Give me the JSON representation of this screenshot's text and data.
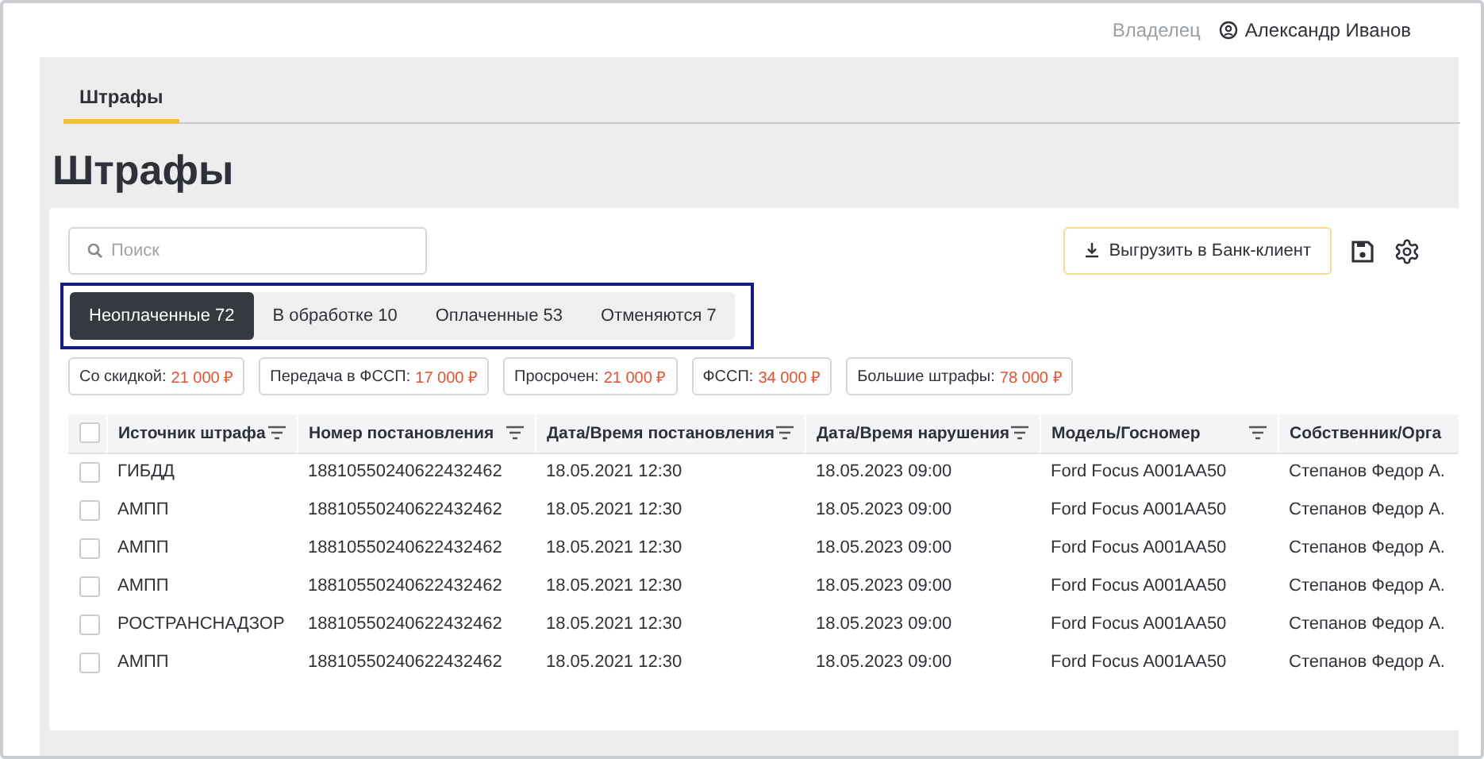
{
  "header": {
    "role": "Владелец",
    "user": "Александр Иванов"
  },
  "nav_tabs": [
    {
      "label": "Штрафы",
      "selected": true
    }
  ],
  "page_title": "Штрафы",
  "search": {
    "placeholder": "Поиск"
  },
  "export_button": "Выгрузить в Банк-клиент",
  "status_tabs": [
    {
      "label": "Неоплаченные 72",
      "selected": true
    },
    {
      "label": "В обработке 10",
      "selected": false
    },
    {
      "label": "Оплаченные 53",
      "selected": false
    },
    {
      "label": "Отменяются 7",
      "selected": false
    }
  ],
  "summary_chips": [
    {
      "label": "Со скидкой:",
      "amount": "21 000 ₽"
    },
    {
      "label": "Передача в ФССП:",
      "amount": "17 000 ₽"
    },
    {
      "label": "Просрочен:",
      "amount": "21 000 ₽"
    },
    {
      "label": "ФССП:",
      "amount": "34 000 ₽"
    },
    {
      "label": "Большие штрафы:",
      "amount": "78 000 ₽"
    }
  ],
  "table": {
    "all_checked": false,
    "columns": [
      {
        "label": "Источник штрафа",
        "filter": true
      },
      {
        "label": "Номер постановления",
        "filter": true
      },
      {
        "label": "Дата/Время постановления",
        "filter": true
      },
      {
        "label": "Дата/Время нарушения",
        "filter": true
      },
      {
        "label": "Модель/Госномер",
        "filter": true
      },
      {
        "label": "Собственник/Орга",
        "filter": false
      }
    ],
    "rows": [
      {
        "checked": false,
        "cells": [
          "ГИБДД",
          "18810550240622432462",
          "18.05.2021 12:30",
          "18.05.2023 09:00",
          "Ford Focus A001AA50",
          "Степанов Федор А."
        ]
      },
      {
        "checked": false,
        "cells": [
          "АМПП",
          "18810550240622432462",
          "18.05.2021 12:30",
          "18.05.2023 09:00",
          "Ford Focus A001AA50",
          "Степанов Федор А."
        ]
      },
      {
        "checked": false,
        "cells": [
          "АМПП",
          "18810550240622432462",
          "18.05.2021 12:30",
          "18.05.2023 09:00",
          "Ford Focus A001AA50",
          "Степанов Федор А."
        ]
      },
      {
        "checked": false,
        "cells": [
          "АМПП",
          "18810550240622432462",
          "18.05.2021 12:30",
          "18.05.2023 09:00",
          "Ford Focus A001AA50",
          "Степанов Федор А."
        ]
      },
      {
        "checked": false,
        "cells": [
          "РОСТРАНСНАДЗОР",
          "18810550240622432462",
          "18.05.2021 12:30",
          "18.05.2023 09:00",
          "Ford Focus A001AA50",
          "Степанов Федор А."
        ]
      },
      {
        "checked": false,
        "cells": [
          "АМПП",
          "18810550240622432462",
          "18.05.2021 12:30",
          "18.05.2023 09:00",
          "Ford Focus A001AA50",
          "Степанов Федор А."
        ]
      }
    ]
  }
}
